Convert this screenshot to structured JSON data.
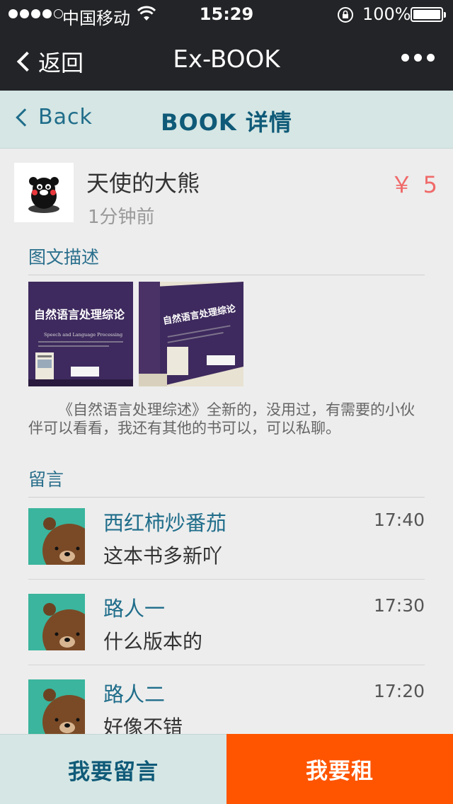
{
  "status_bar": {
    "carrier": "中国移动",
    "time": "15:29",
    "battery": "100%"
  },
  "nav": {
    "back_label": "返回",
    "title": "Ex-BOOK"
  },
  "header": {
    "back_label": "Back",
    "title": "BOOK 详情"
  },
  "book": {
    "seller_name": "天使的大熊",
    "posted_time": "1分钟前",
    "price": "￥ 5",
    "cover_title": "自然语言处理综论",
    "cover_subtitle": "Speech and Language Processing"
  },
  "description": {
    "section_title": "图文描述",
    "text": "《自然语言处理综述》全新的，没用过，有需要的小伙伴可以看看，我还有其他的书可以，可以私聊。"
  },
  "comments": {
    "section_title": "留言",
    "items": [
      {
        "name": "西红柿炒番茄",
        "time": "17:40",
        "text": "这本书多新吖"
      },
      {
        "name": "路人一",
        "time": "17:30",
        "text": "什么版本的"
      },
      {
        "name": "路人二",
        "time": "17:20",
        "text": "好像不错"
      }
    ]
  },
  "actions": {
    "comment_label": "我要留言",
    "rent_label": "我要租"
  },
  "colors": {
    "accent": "#0f5a78",
    "rent_button": "#ff5500",
    "price": "#f06a6a",
    "header_bg": "#d5e6e4"
  }
}
